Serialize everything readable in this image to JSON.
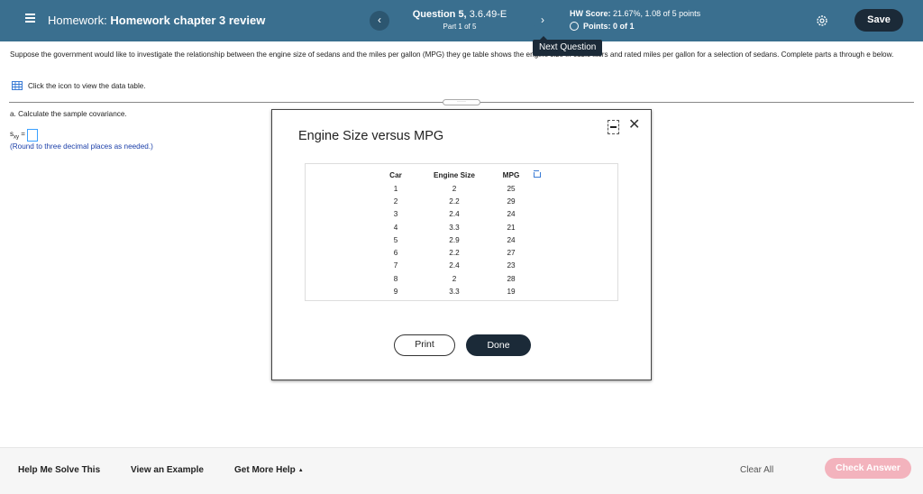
{
  "header": {
    "title_prefix": "Homework:",
    "title": "Homework chapter 3 review",
    "question_label": "Question 5,",
    "question_id": "3.6.49-E",
    "question_part": "Part 1 of 5",
    "prev_glyph": "‹",
    "next_glyph": "›",
    "score_label": "HW Score:",
    "score_value": "21.67%, 1.08 of 5 points",
    "points_label": "Points:",
    "points_value": "0 of 1",
    "save_label": "Save"
  },
  "tooltip": {
    "text": "Next Question"
  },
  "problem": {
    "text": "Suppose the government would like to investigate the relationship between the engine size of sedans and the miles per gallon (MPG) they ge                                       table shows the engine size in cubic liters and rated miles per gallon for a selection of sedans. Complete parts a through e below.",
    "data_link": "Click the icon to view the data table.",
    "handle": "·····"
  },
  "part_a": {
    "prompt": "a. Calculate the sample covariance.",
    "var_base": "s",
    "var_sub": "xy",
    "equals": "=",
    "note": "(Round to three decimal places as needed.)"
  },
  "modal": {
    "title": "Engine Size versus MPG",
    "close_glyph": "✕",
    "columns": [
      "Car",
      "Engine Size",
      "MPG"
    ],
    "rows": [
      [
        "1",
        "2",
        "25"
      ],
      [
        "2",
        "2.2",
        "29"
      ],
      [
        "3",
        "2.4",
        "24"
      ],
      [
        "4",
        "3.3",
        "21"
      ],
      [
        "5",
        "2.9",
        "24"
      ],
      [
        "6",
        "2.2",
        "27"
      ],
      [
        "7",
        "2.4",
        "23"
      ],
      [
        "8",
        "2",
        "28"
      ],
      [
        "9",
        "3.3",
        "19"
      ]
    ],
    "print_label": "Print",
    "done_label": "Done"
  },
  "footer": {
    "help_solve": "Help Me Solve This",
    "view_example": "View an Example",
    "get_help": "Get More Help",
    "get_help_caret": "▲",
    "clear_all": "Clear All",
    "check_answer": "Check Answer"
  },
  "colors": {
    "header_bg": "#3a6f8f",
    "dark_button": "#1b2a38",
    "check_answer_bg": "#f3b3bd",
    "answer_box_border": "#39a0ff",
    "note_text": "#1a3ea8"
  },
  "icons": [
    "menu-icon",
    "gear-icon",
    "table-icon",
    "copy-icon",
    "minimize-icon",
    "close-icon"
  ]
}
